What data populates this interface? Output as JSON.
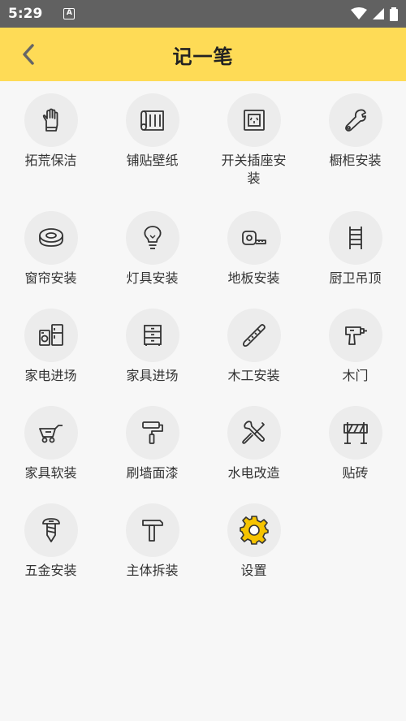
{
  "status": {
    "time": "5:29"
  },
  "header": {
    "title": "记一笔"
  },
  "items": [
    {
      "label": "拓荒保洁",
      "icon": "glove-icon"
    },
    {
      "label": "铺贴壁纸",
      "icon": "wallpaper-roll-icon"
    },
    {
      "label": "开关插座安装",
      "icon": "socket-icon"
    },
    {
      "label": "橱柜安装",
      "icon": "wrench-icon"
    },
    {
      "label": "窗帘安装",
      "icon": "tape-roll-icon"
    },
    {
      "label": "灯具安装",
      "icon": "lightbulb-icon"
    },
    {
      "label": "地板安装",
      "icon": "tape-measure-icon"
    },
    {
      "label": "厨卫吊顶",
      "icon": "ladder-icon"
    },
    {
      "label": "家电进场",
      "icon": "appliance-icon"
    },
    {
      "label": "家具进场",
      "icon": "cabinet-icon"
    },
    {
      "label": "木工安装",
      "icon": "saw-icon"
    },
    {
      "label": "木门",
      "icon": "drill-icon"
    },
    {
      "label": "家具软装",
      "icon": "cart-icon"
    },
    {
      "label": "刷墙面漆",
      "icon": "paint-roller-icon"
    },
    {
      "label": "水电改造",
      "icon": "tools-icon"
    },
    {
      "label": "贴砖",
      "icon": "barrier-icon"
    },
    {
      "label": "五金安装",
      "icon": "screw-icon"
    },
    {
      "label": "主体拆装",
      "icon": "hammer-icon"
    },
    {
      "label": "设置",
      "icon": "gear-icon"
    }
  ],
  "colors": {
    "accent": "#fedb56",
    "status_bar": "#616161",
    "icon_stroke": "#333333",
    "gear": "#f5c300"
  }
}
